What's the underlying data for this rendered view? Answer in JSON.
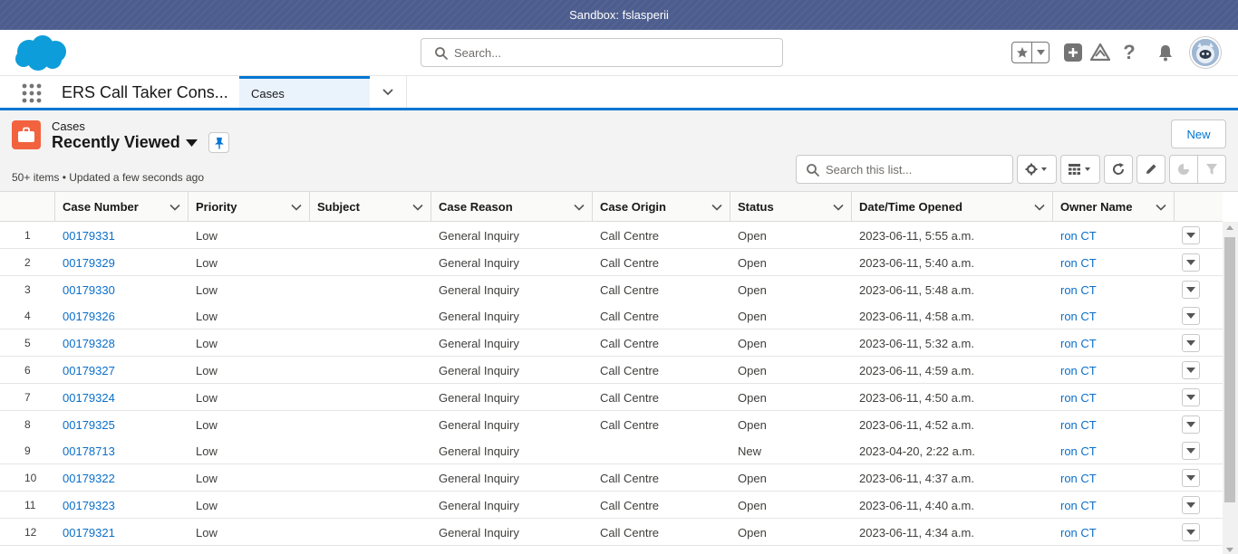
{
  "sandbox": {
    "label": "Sandbox: fslasperii"
  },
  "header": {
    "search_placeholder": "Search...",
    "icons": [
      "favorites-star-icon",
      "favorites-dropdown-icon",
      "global-actions-icon",
      "trailhead-icon",
      "help-icon",
      "notifications-bell-icon",
      "avatar"
    ]
  },
  "app": {
    "name": "ERS Call Taker Cons...",
    "tabs": [
      {
        "label": "Cases"
      }
    ]
  },
  "list": {
    "object_label": "Cases",
    "view_name": "Recently Viewed",
    "meta": "50+ items • Updated a few seconds ago",
    "new_button": "New",
    "search_placeholder": "Search this list...",
    "columns": [
      "Case Number",
      "Priority",
      "Subject",
      "Case Reason",
      "Case Origin",
      "Status",
      "Date/Time Opened",
      "Owner Name"
    ],
    "rows": [
      {
        "n": "1",
        "case": "00179331",
        "priority": "Low",
        "subject": "",
        "reason": "General Inquiry",
        "origin": "Call Centre",
        "status": "Open",
        "opened": "2023-06-11, 5:55 a.m.",
        "owner": "ron CT"
      },
      {
        "n": "2",
        "case": "00179329",
        "priority": "Low",
        "subject": "",
        "reason": "General Inquiry",
        "origin": "Call Centre",
        "status": "Open",
        "opened": "2023-06-11, 5:40 a.m.",
        "owner": "ron CT"
      },
      {
        "n": "3",
        "case": "00179330",
        "priority": "Low",
        "subject": "",
        "reason": "General Inquiry",
        "origin": "Call Centre",
        "status": "Open",
        "opened": "2023-06-11, 5:48 a.m.",
        "owner": "ron CT"
      },
      {
        "n": "4",
        "case": "00179326",
        "priority": "Low",
        "subject": "",
        "reason": "General Inquiry",
        "origin": "Call Centre",
        "status": "Open",
        "opened": "2023-06-11, 4:58 a.m.",
        "owner": "ron CT"
      },
      {
        "n": "5",
        "case": "00179328",
        "priority": "Low",
        "subject": "",
        "reason": "General Inquiry",
        "origin": "Call Centre",
        "status": "Open",
        "opened": "2023-06-11, 5:32 a.m.",
        "owner": "ron CT"
      },
      {
        "n": "6",
        "case": "00179327",
        "priority": "Low",
        "subject": "",
        "reason": "General Inquiry",
        "origin": "Call Centre",
        "status": "Open",
        "opened": "2023-06-11, 4:59 a.m.",
        "owner": "ron CT"
      },
      {
        "n": "7",
        "case": "00179324",
        "priority": "Low",
        "subject": "",
        "reason": "General Inquiry",
        "origin": "Call Centre",
        "status": "Open",
        "opened": "2023-06-11, 4:50 a.m.",
        "owner": "ron CT"
      },
      {
        "n": "8",
        "case": "00179325",
        "priority": "Low",
        "subject": "",
        "reason": "General Inquiry",
        "origin": "Call Centre",
        "status": "Open",
        "opened": "2023-06-11, 4:52 a.m.",
        "owner": "ron CT"
      },
      {
        "n": "9",
        "case": "00178713",
        "priority": "Low",
        "subject": "",
        "reason": "General Inquiry",
        "origin": "",
        "status": "New",
        "opened": "2023-04-20, 2:22 a.m.",
        "owner": "ron CT"
      },
      {
        "n": "10",
        "case": "00179322",
        "priority": "Low",
        "subject": "",
        "reason": "General Inquiry",
        "origin": "Call Centre",
        "status": "Open",
        "opened": "2023-06-11, 4:37 a.m.",
        "owner": "ron CT"
      },
      {
        "n": "11",
        "case": "00179323",
        "priority": "Low",
        "subject": "",
        "reason": "General Inquiry",
        "origin": "Call Centre",
        "status": "Open",
        "opened": "2023-06-11, 4:40 a.m.",
        "owner": "ron CT"
      },
      {
        "n": "12",
        "case": "00179321",
        "priority": "Low",
        "subject": "",
        "reason": "General Inquiry",
        "origin": "Call Centre",
        "status": "Open",
        "opened": "2023-06-11, 4:34 a.m.",
        "owner": "ron CT"
      }
    ]
  },
  "colors": {
    "brand_blue": "#0176d3",
    "case_icon": "#f2623f",
    "link": "#0b6fc9",
    "sandbox": "#4d5e8e"
  }
}
